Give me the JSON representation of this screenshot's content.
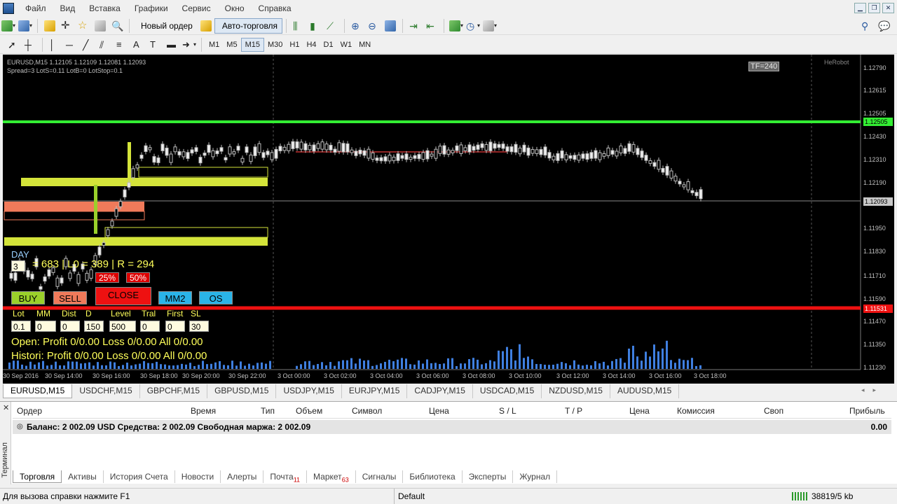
{
  "menu": [
    "Файл",
    "Вид",
    "Вставка",
    "Графики",
    "Сервис",
    "Окно",
    "Справка"
  ],
  "toolbar": {
    "new_order": "Новый ордер",
    "auto_trading": "Авто-торговля",
    "timeframes": [
      "M1",
      "M5",
      "M15",
      "M30",
      "H1",
      "H4",
      "D1",
      "W1",
      "MN"
    ],
    "active_timeframe": "M15"
  },
  "chart": {
    "header_line1": "EURUSD,M15  1.12105 1.12109 1.12081 1.12093",
    "header_line2": "Spread=3  LotS=0.11  LotB=0  LotStop=0.1",
    "tf_badge": "TF=240",
    "robot": "HeRobot",
    "y_labels": [
      "1.12790",
      "1.12615",
      "1.12505",
      "1.12430",
      "1.12310",
      "1.12190",
      "1.12093",
      "1.11950",
      "1.11830",
      "1.11710",
      "1.11590",
      "1.11470",
      "1.11350",
      "1.11230"
    ],
    "green_level": "1.12505",
    "red_level": "1.11531",
    "current_price": "1.12093",
    "x_labels": [
      "30 Sep 2016",
      "30 Sep 14:00",
      "30 Sep 16:00",
      "30 Sep 18:00",
      "30 Sep 20:00",
      "30 Sep 22:00",
      "3 Oct 00:00",
      "3 Oct 02:00",
      "3 Oct 04:00",
      "3 Oct 06:00",
      "3 Oct 08:00",
      "3 Oct 10:00",
      "3 Oct 12:00",
      "3 Oct 14:00",
      "3 Oct 16:00",
      "3 Oct 18:00"
    ],
    "colors": {
      "bg": "#000000",
      "green": "#33ee33",
      "red": "#ee1111",
      "zone": "#d4e43a",
      "salmon": "#f07a5a",
      "volume": "#3f7fe0"
    }
  },
  "panel": {
    "day_label": "DAY",
    "day_value": "3",
    "stats": "= 683 | L0 = 389 | R = 294",
    "pct1": "25%",
    "pct2": "50%",
    "buy": "BUY",
    "sell": "SELL",
    "close": "CLOSE",
    "mm2": "MM2",
    "os": "OS",
    "params": [
      {
        "label": "Lot",
        "value": "0.1"
      },
      {
        "label": "MM",
        "value": "0"
      },
      {
        "label": "Dist",
        "value": "0"
      },
      {
        "label": "D",
        "value": "150"
      },
      {
        "label": "Level",
        "value": "500"
      },
      {
        "label": "Tral",
        "value": "0"
      },
      {
        "label": "First",
        "value": "0"
      },
      {
        "label": "SL",
        "value": "30"
      }
    ],
    "open_line": "Open:  Profit 0/0.00   Loss 0/0.00   All 0/0.00",
    "history_line": "Histori: Profit 0/0.00   Loss 0/0.00   All 0/0.00"
  },
  "chart_tabs": [
    "EURUSD,M15",
    "USDCHF,M15",
    "GBPCHF,M15",
    "GBPUSD,M15",
    "USDJPY,M15",
    "EURJPY,M15",
    "CADJPY,M15",
    "USDCAD,M15",
    "NZDUSD,M15",
    "AUDUSD,M15"
  ],
  "terminal": {
    "side_title": "Терминал",
    "columns": [
      "Ордер",
      "Время",
      "Тип",
      "Объем",
      "Символ",
      "Цена",
      "S / L",
      "T / P",
      "Цена",
      "Комиссия",
      "Своп",
      "Прибыль"
    ],
    "balance_line": "Баланс: 2 002.09 USD  Средства: 2 002.09  Свободная маржа: 2 002.09",
    "profit": "0.00",
    "tabs": [
      {
        "label": "Торговля",
        "badge": ""
      },
      {
        "label": "Активы",
        "badge": ""
      },
      {
        "label": "История Счета",
        "badge": ""
      },
      {
        "label": "Новости",
        "badge": ""
      },
      {
        "label": "Алерты",
        "badge": ""
      },
      {
        "label": "Почта",
        "badge": "11"
      },
      {
        "label": "Маркет",
        "badge": "63"
      },
      {
        "label": "Сигналы",
        "badge": ""
      },
      {
        "label": "Библиотека",
        "badge": ""
      },
      {
        "label": "Эксперты",
        "badge": ""
      },
      {
        "label": "Журнал",
        "badge": ""
      }
    ]
  },
  "status": {
    "help": "Для вызова справки нажмите F1",
    "profile": "Default",
    "traffic": "38819/5 kb"
  }
}
